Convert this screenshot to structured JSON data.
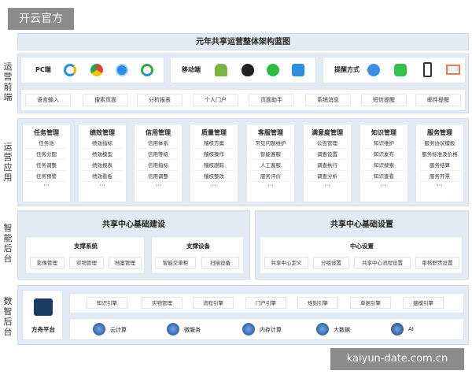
{
  "watermark_top": "开云官方",
  "watermark_bottom": "kaiyun-date.com.cn",
  "title": "元年共享运营整体架构蓝图",
  "sidebar": {
    "front": [
      "运",
      "营",
      "前",
      "端"
    ],
    "app": [
      "运",
      "营",
      "应",
      "用"
    ],
    "smart": [
      "智",
      "能",
      "后",
      "台"
    ],
    "data": [
      "数",
      "智",
      "后",
      "台"
    ]
  },
  "channels": [
    {
      "label": "PC端",
      "icons": [
        "ie-icon",
        "chrome-icon",
        "safari-icon",
        "edge-icon"
      ]
    },
    {
      "label": "移动端",
      "icons": [
        "android-icon",
        "apple-icon",
        "wechat-icon",
        "app-icon"
      ]
    },
    {
      "label": "提醒方式",
      "icons": [
        "robot-icon",
        "message-icon",
        "phone-icon",
        "mail-icon"
      ]
    }
  ],
  "front_functions": [
    "语言输入",
    "搜索页面",
    "分析报表",
    "个人门户",
    "页面助手",
    "系统消息",
    "短信提醒",
    "邮件提醒"
  ],
  "modules": [
    {
      "title": "任务管理",
      "items": [
        "任务池",
        "任务分配",
        "任务调整",
        "任务预警"
      ]
    },
    {
      "title": "绩效管理",
      "items": [
        "绩效指标",
        "绩效模型",
        "绩效报表",
        "绩效看板"
      ]
    },
    {
      "title": "信用管理",
      "items": [
        "信用体系",
        "信用等级",
        "信用指标",
        "信用调整"
      ]
    },
    {
      "title": "质量管理",
      "items": [
        "稽核方案",
        "稽核操作",
        "稽核跟踪",
        "稽核整改"
      ]
    },
    {
      "title": "客服管理",
      "items": [
        "常见问题维护",
        "智能客服",
        "人工客服",
        "服务评价"
      ]
    },
    {
      "title": "满意度管理",
      "items": [
        "公告管理",
        "调查设置",
        "调查执行",
        "调查分析"
      ]
    },
    {
      "title": "知识管理",
      "items": [
        "知识维护",
        "知识发布",
        "知识搜索",
        "知识查看"
      ]
    },
    {
      "title": "服务管理",
      "items": [
        "服务协议模板",
        "服务标准及价格",
        "服务结算",
        "服务开票"
      ]
    }
  ],
  "ellipsis": "···",
  "build": {
    "title": "共享中心基础建设",
    "support_system": {
      "title": "支撑系统",
      "items": [
        "影像管理",
        "实物管理",
        "档案管理"
      ]
    },
    "support_device": {
      "title": "支撑设备",
      "items": [
        "智能交单柜",
        "扫描设备"
      ]
    }
  },
  "settings": {
    "title": "共享中心基础设置",
    "center": {
      "title": "中心设置",
      "items": [
        "共享中心定义",
        "分组设置",
        "共享中心流程设置",
        "审核职责设置"
      ]
    }
  },
  "platform": {
    "name": "方舟平台",
    "engines": [
      "知识引擎",
      "实物管理",
      "流程引擎",
      "门户引擎",
      "规则引擎",
      "单据引擎",
      "建模引擎"
    ],
    "tech": [
      {
        "label": "云计算",
        "icon": "cloud-icon"
      },
      {
        "label": "微服务",
        "icon": "microservice-icon"
      },
      {
        "label": "内存计算",
        "icon": "memory-icon"
      },
      {
        "label": "大数据",
        "icon": "bigdata-icon"
      },
      {
        "label": "AI",
        "icon": "ai-icon"
      }
    ]
  },
  "colors": {
    "band": "#e3eaf3",
    "accent": "#2f6fd6",
    "dark": "#1e3a66"
  }
}
